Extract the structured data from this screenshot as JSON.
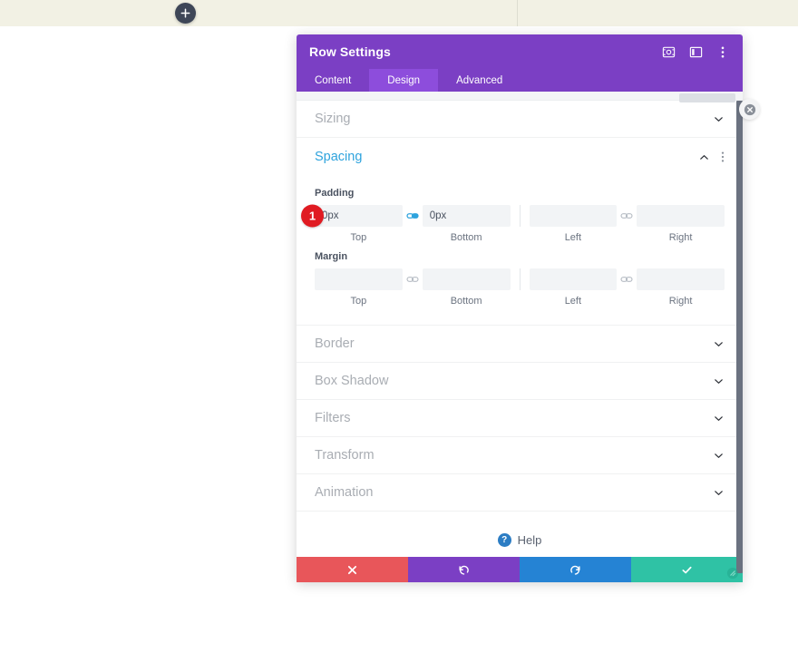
{
  "page": {
    "add_row_button_icon": "plus-icon"
  },
  "modal": {
    "title": "Row Settings",
    "header_icons": [
      {
        "name": "focus-icon"
      },
      {
        "name": "layout-split-icon"
      },
      {
        "name": "more-vertical-icon"
      }
    ],
    "tabs": [
      {
        "label": "Content",
        "active": false
      },
      {
        "label": "Design",
        "active": true
      },
      {
        "label": "Advanced",
        "active": false
      }
    ],
    "close_icon": "close-circle-icon",
    "scrollbar": "vertical-scrollbar",
    "resize_handle": "resize-handle-icon"
  },
  "sections": {
    "sizing": {
      "label": "Sizing",
      "expanded": false,
      "caret": "chevron-down-icon"
    },
    "spacing": {
      "label": "Spacing",
      "expanded": true,
      "caret": "chevron-up-icon",
      "menu_icon": "more-vertical-icon",
      "step_badge": "1",
      "padding": {
        "label": "Padding",
        "top": {
          "value": "0px",
          "caption": "Top"
        },
        "bottom": {
          "value": "0px",
          "caption": "Bottom"
        },
        "left": {
          "value": "",
          "caption": "Left"
        },
        "right": {
          "value": "",
          "caption": "Right"
        },
        "link_tb_icon": "link-active-icon",
        "link_lr_icon": "link-inactive-icon"
      },
      "margin": {
        "label": "Margin",
        "top": {
          "value": "",
          "caption": "Top"
        },
        "bottom": {
          "value": "",
          "caption": "Bottom"
        },
        "left": {
          "value": "",
          "caption": "Left"
        },
        "right": {
          "value": "",
          "caption": "Right"
        },
        "link_tb_icon": "link-inactive-icon",
        "link_lr_icon": "link-inactive-icon"
      }
    },
    "collapsed": [
      {
        "label": "Border",
        "caret": "chevron-down-icon"
      },
      {
        "label": "Box Shadow",
        "caret": "chevron-down-icon"
      },
      {
        "label": "Filters",
        "caret": "chevron-down-icon"
      },
      {
        "label": "Transform",
        "caret": "chevron-down-icon"
      },
      {
        "label": "Animation",
        "caret": "chevron-down-icon"
      }
    ]
  },
  "help": {
    "icon": "help-circle-icon",
    "label": "Help"
  },
  "footer": {
    "cancel": {
      "icon": "times-icon",
      "label": ""
    },
    "undo": {
      "icon": "undo-icon",
      "label": ""
    },
    "redo": {
      "icon": "redo-icon",
      "label": ""
    },
    "save": {
      "icon": "checkmark-icon",
      "label": ""
    }
  },
  "colors": {
    "brand_purple": "#7b3fc4",
    "tab_active": "#8d4ddc",
    "accent_blue": "#2ea3dd",
    "badge_red": "#e01b22",
    "cancel_red": "#e8565a",
    "redo_blue": "#2583d4",
    "save_green": "#2fc2a5",
    "page_strip": "#f2f1e4"
  }
}
